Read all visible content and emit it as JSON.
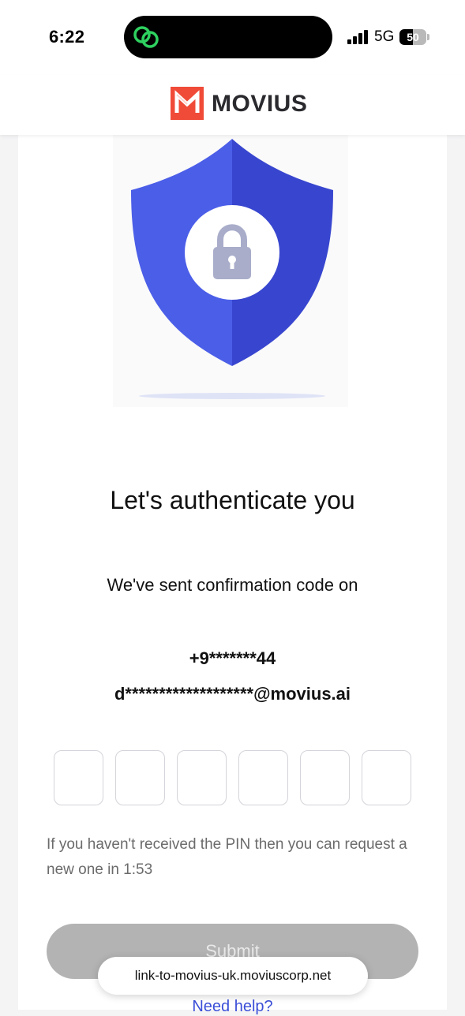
{
  "status_bar": {
    "time": "6:22",
    "network": "5G",
    "battery_level": "50",
    "battery_fraction": 0.5,
    "island_icon": "chat-rings-icon",
    "island_icon_color": "#2ed15f"
  },
  "header": {
    "brand_name": "MOVIUS",
    "logo_icon": "movius-m-logo-icon",
    "logo_color": "#f04b38"
  },
  "illustration": {
    "icon": "shield-lock-icon",
    "shield_colors": [
      "#4b5ee8",
      "#3846cf"
    ]
  },
  "auth": {
    "heading": "Let's authenticate you",
    "sent_text": "We've sent confirmation code on",
    "phone_masked": "+9*******44",
    "email_masked": "d*******************@movius.ai",
    "pin_digits": [
      "",
      "",
      "",
      "",
      "",
      ""
    ],
    "resend_text": "If you haven't received the PIN then you can request a new one in 1:53",
    "submit_label": "Submit",
    "help_label": "Need help?"
  },
  "browser": {
    "url": "link-to-movius-uk.moviuscorp.net"
  },
  "colors": {
    "accent": "#3b4fd8",
    "submit_disabled": "#b3b3b3"
  }
}
